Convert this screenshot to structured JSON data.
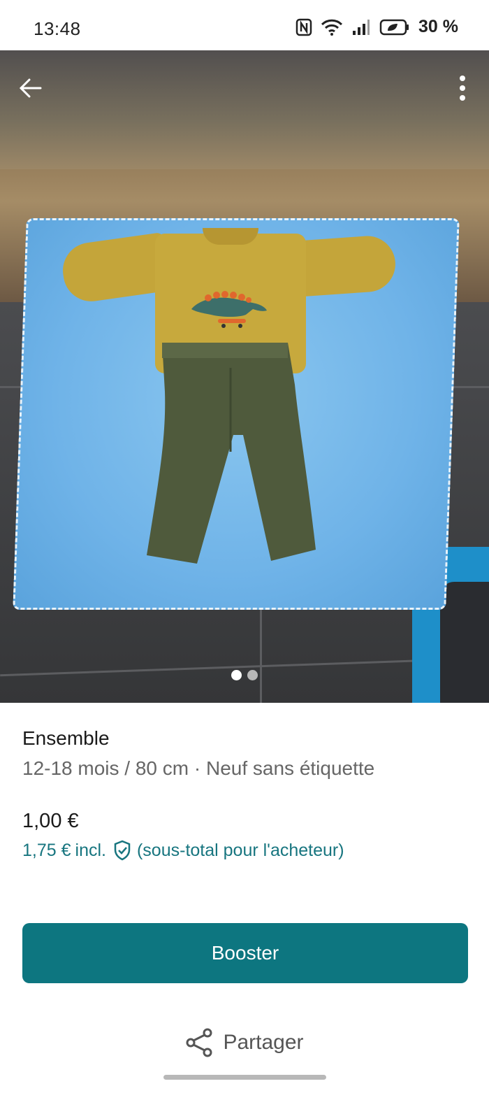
{
  "status_bar": {
    "time": "13:48",
    "battery": "30 %",
    "icons": [
      "nfc-icon",
      "wifi-icon",
      "signal-icon",
      "battery-saver-icon"
    ]
  },
  "gallery": {
    "image_count": 2,
    "active_index": 0,
    "back_icon": "arrow-left-icon",
    "more_icon": "more-vertical-icon"
  },
  "item": {
    "title": "Ensemble",
    "meta": "12-18 mois / 80 cm · Neuf sans étiquette",
    "price": "1,00 €",
    "price_incl": "1,75 €",
    "incl_label": "incl.",
    "subtotal_note": "(sous-total pour l'acheteur)"
  },
  "actions": {
    "booster_label": "Booster",
    "share_label": "Partager"
  },
  "colors": {
    "accent": "#0d7680",
    "accent_text": "#17757f"
  }
}
